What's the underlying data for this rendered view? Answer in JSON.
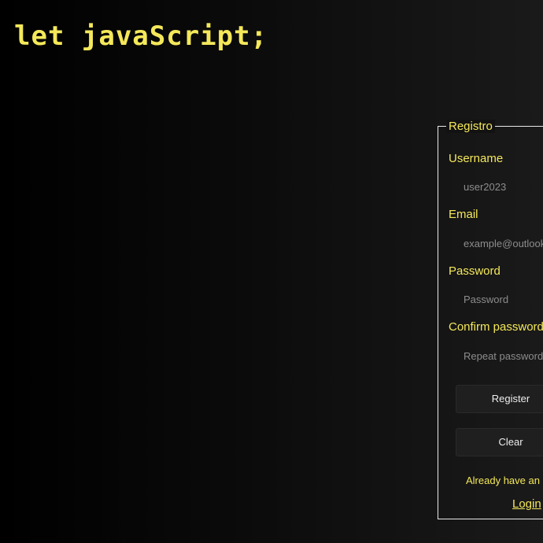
{
  "app": {
    "title": "let javaScript;"
  },
  "form": {
    "legend": "Registro",
    "fields": [
      {
        "label": "Username",
        "placeholder": "user2023"
      },
      {
        "label": "Email",
        "placeholder": "example@outlook"
      },
      {
        "label": "Password",
        "placeholder": "Password"
      },
      {
        "label": "Confirm password",
        "placeholder": "Repeat password"
      }
    ],
    "buttons": {
      "register": "Register",
      "clear": "Clear"
    },
    "already_text": "Already have an",
    "login_link": "Login"
  },
  "colors": {
    "accent": "#f4e85a",
    "background": "#000000",
    "input_text": "#8d8d8d",
    "button_bg": "#1f1f1f"
  }
}
